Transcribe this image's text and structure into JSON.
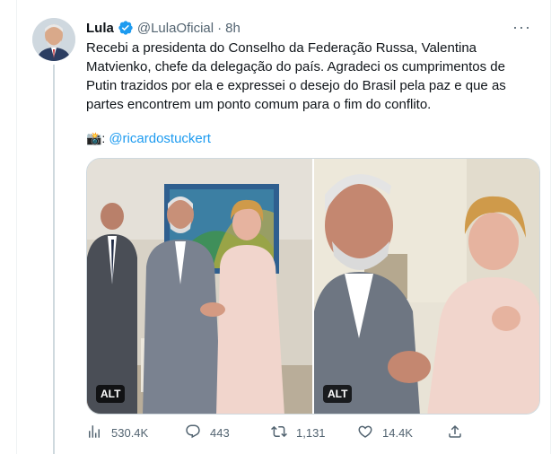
{
  "tweet": {
    "author_name": "Lula",
    "handle": "@LulaOficial",
    "separator": "·",
    "time": "8h",
    "text": "Recebi a presidenta do Conselho da Federação Russa, Valentina Matvienko, chefe da delegação do país. Agradeci os cumprimentos de Putin trazidos por ela e expressei o desejo do Brasil pela paz e que as partes encontrem um ponto comum para o fim do conflito.",
    "credit_icon": "📸:",
    "credit_link": "@ricardostuckert",
    "more_icon": "···"
  },
  "media": {
    "photos": [
      {
        "alt_badge": "ALT"
      },
      {
        "alt_badge": "ALT"
      }
    ]
  },
  "actions": {
    "views": "530.4K",
    "replies": "443",
    "retweets": "1,131",
    "likes": "14.4K"
  },
  "colors": {
    "accent": "#1d9bf0",
    "secondary_text": "#536471",
    "border": "#cfd9de"
  },
  "icons": [
    "verified-badge-icon",
    "more-icon",
    "camera-icon",
    "views-icon",
    "reply-icon",
    "retweet-icon",
    "like-icon",
    "share-icon"
  ]
}
